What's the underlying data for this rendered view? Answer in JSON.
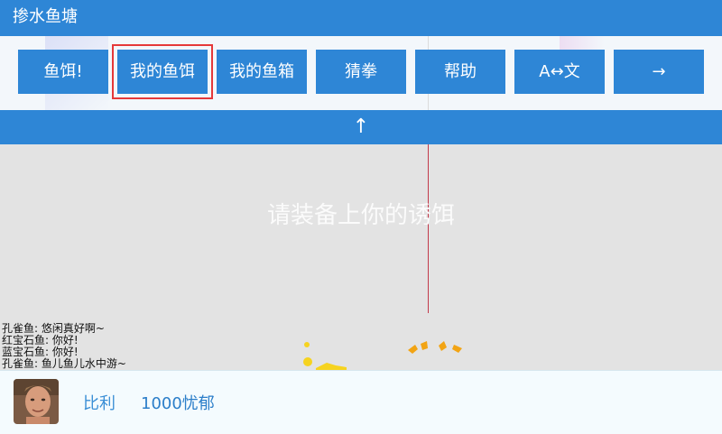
{
  "window": {
    "title": "掺水鱼塘"
  },
  "toolbar": {
    "buttons": [
      {
        "label": "鱼饵!"
      },
      {
        "label": "我的鱼饵",
        "selected": true
      },
      {
        "label": "我的鱼箱"
      },
      {
        "label": "猜拳"
      },
      {
        "label": "帮助"
      },
      {
        "label": "A↔文"
      },
      {
        "label": "→"
      }
    ]
  },
  "scroll_up": {
    "label": "↑"
  },
  "pond": {
    "prompt": "请装备上你的诱饵",
    "chat": [
      "孔雀鱼: 悠闲真好啊~",
      "红宝石鱼: 你好!",
      "蓝宝石鱼: 你好!",
      "孔雀鱼: 鱼儿鱼儿水中游~"
    ]
  },
  "player": {
    "name": "比利",
    "mood": "1000忧郁",
    "avatar_icon": "player-avatar-photo"
  },
  "colors": {
    "primary": "#2e86d6",
    "selected_outline": "#e5393a",
    "fishing_line": "#c23a4b",
    "fish_orange": "#f2a414",
    "fish_yellow": "#f6d31f"
  }
}
